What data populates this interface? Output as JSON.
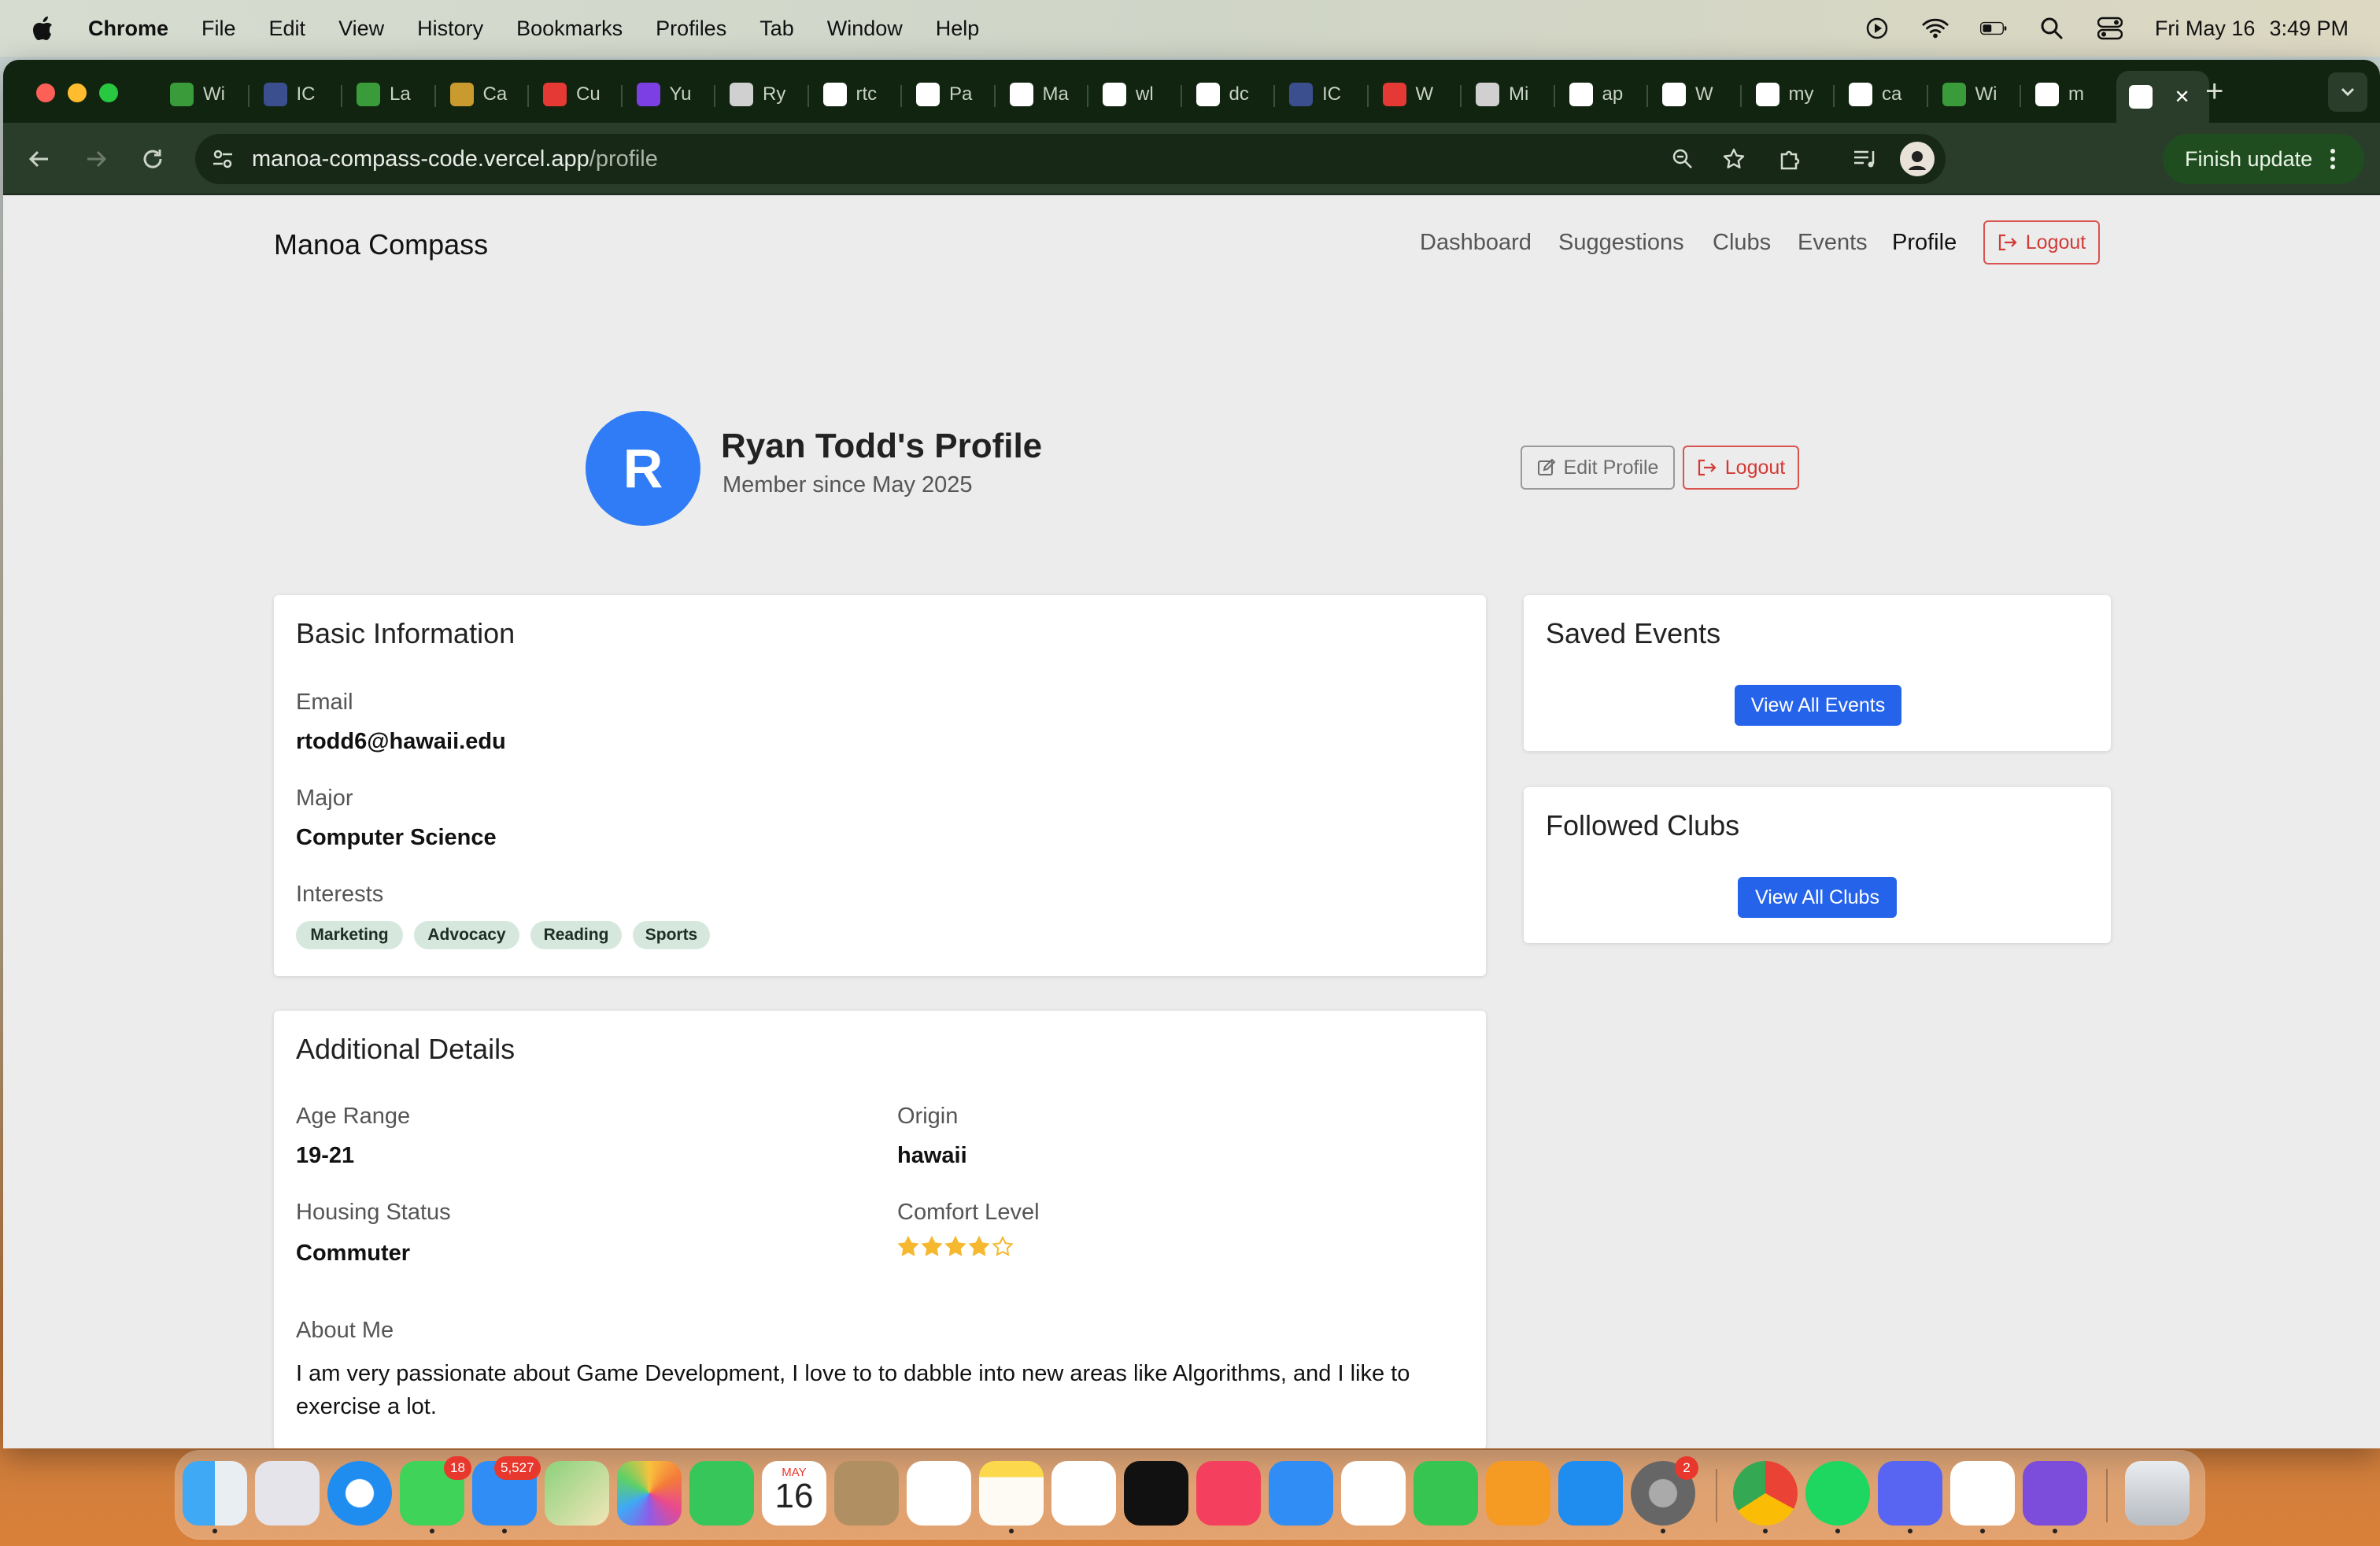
{
  "menubar": {
    "items": [
      "Chrome",
      "File",
      "Edit",
      "View",
      "History",
      "Bookmarks",
      "Profiles",
      "Tab",
      "Window",
      "Help"
    ],
    "date": "Fri May 16",
    "time": "3:49 PM"
  },
  "browser": {
    "tabs": [
      "Wi",
      "IC",
      "La",
      "Ca",
      "Cu",
      "Yu",
      "Ry",
      "rtc",
      "Pa",
      "Ma",
      "wl",
      "dc",
      "IC",
      "W",
      "Mi",
      "ap",
      "W",
      "my",
      "ca",
      "Wi",
      "m",
      ""
    ],
    "url_host": "manoa-compass-code.vercel.app",
    "url_path": "/profile",
    "finish_update": "Finish update"
  },
  "navbar": {
    "brand": "Manoa Compass",
    "links": [
      "Dashboard",
      "Suggestions",
      "Clubs",
      "Events",
      "Profile"
    ],
    "logout": "Logout"
  },
  "profile": {
    "initial": "R",
    "title": "Ryan Todd's Profile",
    "member_since": "Member since May 2025",
    "edit_button": "Edit Profile",
    "logout_button": "Logout"
  },
  "basic_info": {
    "title": "Basic Information",
    "email_label": "Email",
    "email": "rtodd6@hawaii.edu",
    "major_label": "Major",
    "major": "Computer Science",
    "interests_label": "Interests",
    "interests": [
      "Marketing",
      "Advocacy",
      "Reading",
      "Sports"
    ]
  },
  "additional": {
    "title": "Additional Details",
    "age_label": "Age Range",
    "age": "19-21",
    "origin_label": "Origin",
    "origin": "hawaii",
    "housing_label": "Housing Status",
    "housing": "Commuter",
    "comfort_label": "Comfort Level",
    "comfort_rating": 4,
    "comfort_max": 5,
    "about_label": "About Me",
    "about": "I am very passionate about Game Development, I love to to dabble into new areas like Algorithms, and I like to exercise a lot."
  },
  "saved_events": {
    "title": "Saved Events",
    "button": "View All Events"
  },
  "followed_clubs": {
    "title": "Followed Clubs",
    "button": "View All Clubs"
  },
  "dock": {
    "messages_badge": "18",
    "mail_badge": "5,527",
    "settings_badge": "2",
    "calendar_month": "MAY",
    "calendar_day": "16"
  },
  "colors": {
    "primary": "#2563eb",
    "avatar": "#2f7cf6",
    "danger": "#d9534f",
    "pill": "#d6e8de",
    "star": "#f5b82e"
  }
}
